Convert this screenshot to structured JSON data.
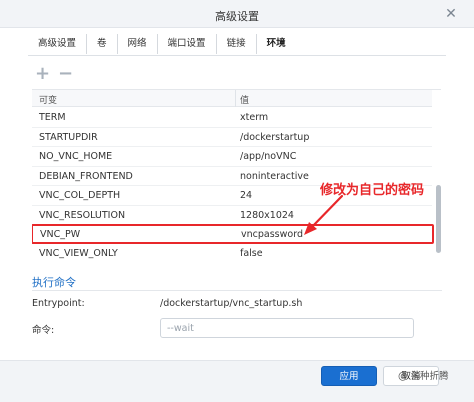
{
  "window": {
    "title": "高级设置",
    "close_glyph": "✕"
  },
  "tabs": [
    {
      "label": "高级设置"
    },
    {
      "label": "卷"
    },
    {
      "label": "网络"
    },
    {
      "label": "端口设置"
    },
    {
      "label": "链接"
    },
    {
      "label": "环境",
      "active": true
    }
  ],
  "toolbar": {
    "add_glyph": "+",
    "remove_glyph": "−"
  },
  "env_table": {
    "headers": {
      "variable": "可变",
      "value": "值"
    },
    "rows": [
      {
        "key": "TERM",
        "value": "xterm"
      },
      {
        "key": "STARTUPDIR",
        "value": "/dockerstartup"
      },
      {
        "key": "NO_VNC_HOME",
        "value": "/app/noVNC"
      },
      {
        "key": "DEBIAN_FRONTEND",
        "value": "noninteractive"
      },
      {
        "key": "VNC_COL_DEPTH",
        "value": "24"
      },
      {
        "key": "VNC_RESOLUTION",
        "value": "1280x1024"
      },
      {
        "key": "VNC_PW",
        "value": "vncpassword",
        "highlighted": true
      },
      {
        "key": "VNC_VIEW_ONLY",
        "value": "false"
      }
    ]
  },
  "annotation": {
    "text": "修改为自己的密码",
    "color": "#e8272a"
  },
  "execute": {
    "section_title": "执行命令",
    "entrypoint_label": "Entrypoint:",
    "entrypoint_value": "/dockerstartup/vnc_startup.sh",
    "command_label": "命令:",
    "command_placeholder": "--wait"
  },
  "buttons": {
    "apply": "应用",
    "cancel": "取消"
  },
  "watermark": "@ 各种折腾",
  "colors": {
    "accent": "#1a6fd1",
    "highlight": "#e8272a"
  }
}
